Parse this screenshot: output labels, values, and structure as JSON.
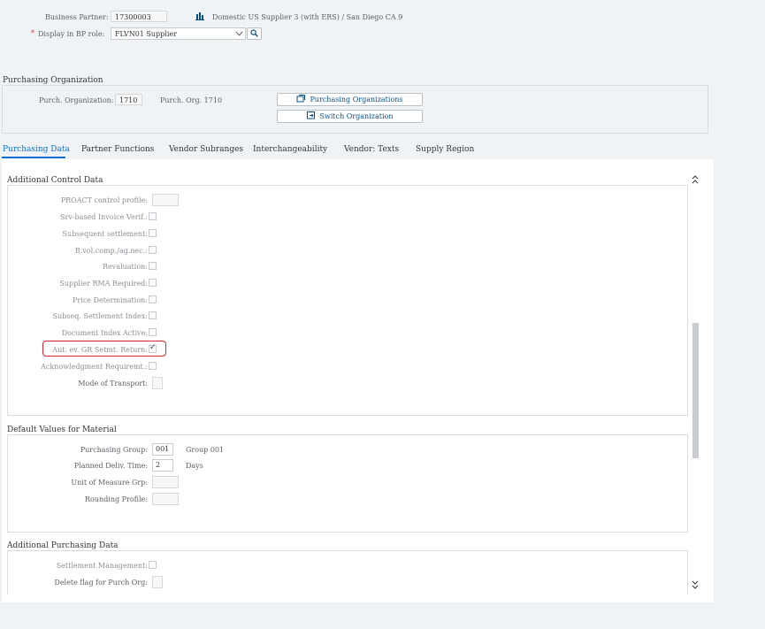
{
  "header": {
    "bp_label": "Business Partner:",
    "bp_value": "17300003",
    "bp_description": "Domestic US Supplier 3 (with ERS) / San Diego CA 9",
    "role_label": "Display in BP role:",
    "role_value": "FLVN01 Supplier",
    "required_mark": "*"
  },
  "purch_org": {
    "title": "Purchasing Organization",
    "label": "Purch. Organization:",
    "value": "1710",
    "description": "Purch. Org. 1710",
    "btn_orgs": "Purchasing Organizations",
    "btn_switch": "Switch Organization"
  },
  "tabs": [
    {
      "label": "Purchasing Data",
      "active": true
    },
    {
      "label": "Partner Functions"
    },
    {
      "label": "Vendor Subranges"
    },
    {
      "label": "Interchangeability"
    },
    {
      "label": "Vendor: Texts"
    },
    {
      "label": "Supply Region"
    }
  ],
  "control": {
    "title": "Additional Control Data",
    "rows": [
      {
        "label": "PROACT control profile:",
        "type": "input"
      },
      {
        "label": "Srv-based Invoice Verif.:",
        "type": "checkbox"
      },
      {
        "label": "Subsequent settlement:",
        "type": "checkbox"
      },
      {
        "label": "B.vol.comp./ag.nec.:",
        "type": "checkbox"
      },
      {
        "label": "Revaluation:",
        "type": "checkbox"
      },
      {
        "label": "Supplier RMA Required:",
        "type": "checkbox"
      },
      {
        "label": "Price Determination:",
        "type": "checkbox"
      },
      {
        "label": "Subseq. Settlement Index:",
        "type": "checkbox"
      },
      {
        "label": "Document Index Active:",
        "type": "checkbox"
      },
      {
        "label": "Aut. ev. GR Setmt. Return:",
        "type": "checkbox",
        "checked": true,
        "highlighted": true
      },
      {
        "label": "Acknowledgment Requiremt.:",
        "type": "checkbox"
      },
      {
        "label": "Mode of Transport:",
        "type": "input"
      }
    ],
    "check_mark": "✓"
  },
  "material": {
    "title": "Default Values for Material",
    "purch_group_label": "Purchasing Group:",
    "purch_group_value": "001",
    "purch_group_desc": "Group 001",
    "deliv_label": "Planned Deliv. Time:",
    "deliv_value": "2",
    "deliv_unit": "Days",
    "uom_label": "Unit of Measure Grp:",
    "rounding_label": "Rounding Profile:"
  },
  "additional": {
    "title": "Additional Purchasing Data",
    "settlement_label": "Settlement Management:",
    "delete_flag_label": "Delete flag for Purch Org:"
  },
  "colors": {
    "accent": "#0a6ed1",
    "highlight": "#d9262c",
    "background": "#f0f3f6"
  }
}
